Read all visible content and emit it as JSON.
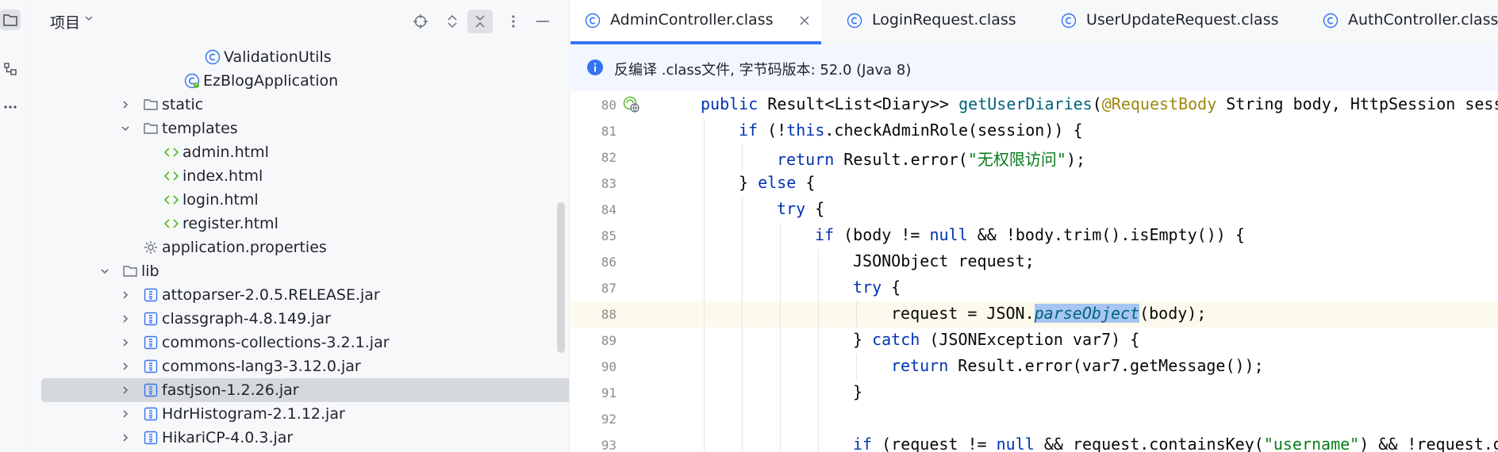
{
  "project_panel": {
    "title": "项目",
    "tree": [
      {
        "label": "ValidationUtils",
        "icon": "class-icon",
        "indent": 6
      },
      {
        "label": "EzBlogApplication",
        "icon": "spring-boot-class-icon",
        "indent": 5
      },
      {
        "label": "static",
        "icon": "folder-icon",
        "indent": 3,
        "expanded": false
      },
      {
        "label": "templates",
        "icon": "folder-icon",
        "indent": 3,
        "expanded": true
      },
      {
        "label": "admin.html",
        "icon": "html-icon",
        "indent": 4
      },
      {
        "label": "index.html",
        "icon": "html-icon",
        "indent": 4
      },
      {
        "label": "login.html",
        "icon": "html-icon",
        "indent": 4
      },
      {
        "label": "register.html",
        "icon": "html-icon",
        "indent": 4
      },
      {
        "label": "application.properties",
        "icon": "properties-icon",
        "indent": 3
      },
      {
        "label": "lib",
        "icon": "folder-icon",
        "indent": 2,
        "expanded": true
      },
      {
        "label": "attoparser-2.0.5.RELEASE.jar",
        "icon": "jar-icon",
        "indent": 3,
        "expanded": false
      },
      {
        "label": "classgraph-4.8.149.jar",
        "icon": "jar-icon",
        "indent": 3,
        "expanded": false
      },
      {
        "label": "commons-collections-3.2.1.jar",
        "icon": "jar-icon",
        "indent": 3,
        "expanded": false
      },
      {
        "label": "commons-lang3-3.12.0.jar",
        "icon": "jar-icon",
        "indent": 3,
        "expanded": false
      },
      {
        "label": "fastjson-1.2.26.jar",
        "icon": "jar-icon",
        "indent": 3,
        "expanded": false,
        "selected": true
      },
      {
        "label": "HdrHistogram-2.1.12.jar",
        "icon": "jar-icon",
        "indent": 3,
        "expanded": false
      },
      {
        "label": "HikariCP-4.0.3.jar",
        "icon": "jar-icon",
        "indent": 3,
        "expanded": false
      }
    ]
  },
  "tabs": [
    {
      "label": "AdminController.class",
      "active": true,
      "closable": true
    },
    {
      "label": "LoginRequest.class",
      "active": false
    },
    {
      "label": "UserUpdateRequest.class",
      "active": false
    },
    {
      "label": "AuthController.class",
      "active": false
    }
  ],
  "banner": {
    "text": "反编译 .class文件, 字节码版本: 52.0 (Java 8)"
  },
  "code_lines": [
    {
      "num": "80",
      "indent": 0,
      "current": false,
      "gutter_icon": "endpoint-icon",
      "tokens": [
        [
          "kw",
          "public "
        ],
        [
          "",
          "Result<List<Diary>> "
        ],
        [
          "fn",
          "getUserDiaries"
        ],
        [
          "",
          "("
        ],
        [
          "ann",
          "@RequestBody"
        ],
        [
          "",
          " String body, HttpSession sess"
        ]
      ]
    },
    {
      "num": "81",
      "indent": 1,
      "tokens": [
        [
          "kw",
          "if "
        ],
        [
          "",
          "(!"
        ],
        [
          "kw",
          "this"
        ],
        [
          "",
          ".checkAdminRole(session)) {"
        ]
      ]
    },
    {
      "num": "82",
      "indent": 2,
      "tokens": [
        [
          "kw",
          "return "
        ],
        [
          "",
          "Result.error("
        ],
        [
          "str",
          "\"无权限访问\""
        ],
        [
          "",
          ");"
        ]
      ]
    },
    {
      "num": "83",
      "indent": 1,
      "tokens": [
        [
          "",
          "} "
        ],
        [
          "kw",
          "else "
        ],
        [
          "",
          "{"
        ]
      ]
    },
    {
      "num": "84",
      "indent": 2,
      "tokens": [
        [
          "kw",
          "try "
        ],
        [
          "",
          "{"
        ]
      ]
    },
    {
      "num": "85",
      "indent": 3,
      "tokens": [
        [
          "kw",
          "if "
        ],
        [
          "",
          "(body != "
        ],
        [
          "kw",
          "null "
        ],
        [
          "",
          "&& !body.trim().isEmpty()) {"
        ]
      ]
    },
    {
      "num": "86",
      "indent": 4,
      "tokens": [
        [
          "",
          "JSONObject request;"
        ]
      ]
    },
    {
      "num": "87",
      "indent": 4,
      "tokens": [
        [
          "kw",
          "try "
        ],
        [
          "",
          "{"
        ]
      ]
    },
    {
      "num": "88",
      "indent": 5,
      "current": true,
      "tokens": [
        [
          "",
          "request = JSON."
        ],
        [
          "hl",
          "parseObject"
        ],
        [
          "",
          "(body);"
        ]
      ]
    },
    {
      "num": "89",
      "indent": 4,
      "tokens": [
        [
          "",
          "} "
        ],
        [
          "kw",
          "catch "
        ],
        [
          "",
          "(JSONException var7) {"
        ]
      ]
    },
    {
      "num": "90",
      "indent": 5,
      "tokens": [
        [
          "kw",
          "return "
        ],
        [
          "",
          "Result.error(var7.getMessage());"
        ]
      ]
    },
    {
      "num": "91",
      "indent": 4,
      "tokens": [
        [
          "",
          "}"
        ]
      ]
    },
    {
      "num": "92",
      "indent": 4,
      "tokens": []
    },
    {
      "num": "93",
      "indent": 4,
      "tokens": [
        [
          "kw",
          "if "
        ],
        [
          "",
          "(request != "
        ],
        [
          "kw",
          "null "
        ],
        [
          "",
          "&& request.containsKey("
        ],
        [
          "str",
          "\"username\""
        ],
        [
          "",
          ") && !request.g"
        ]
      ]
    }
  ],
  "colors": {
    "accent": "#3574f0",
    "keyword": "#0033b3",
    "string": "#067d17",
    "annotation": "#9e880d",
    "method": "#00627a",
    "selection": "#a6c5f2"
  }
}
